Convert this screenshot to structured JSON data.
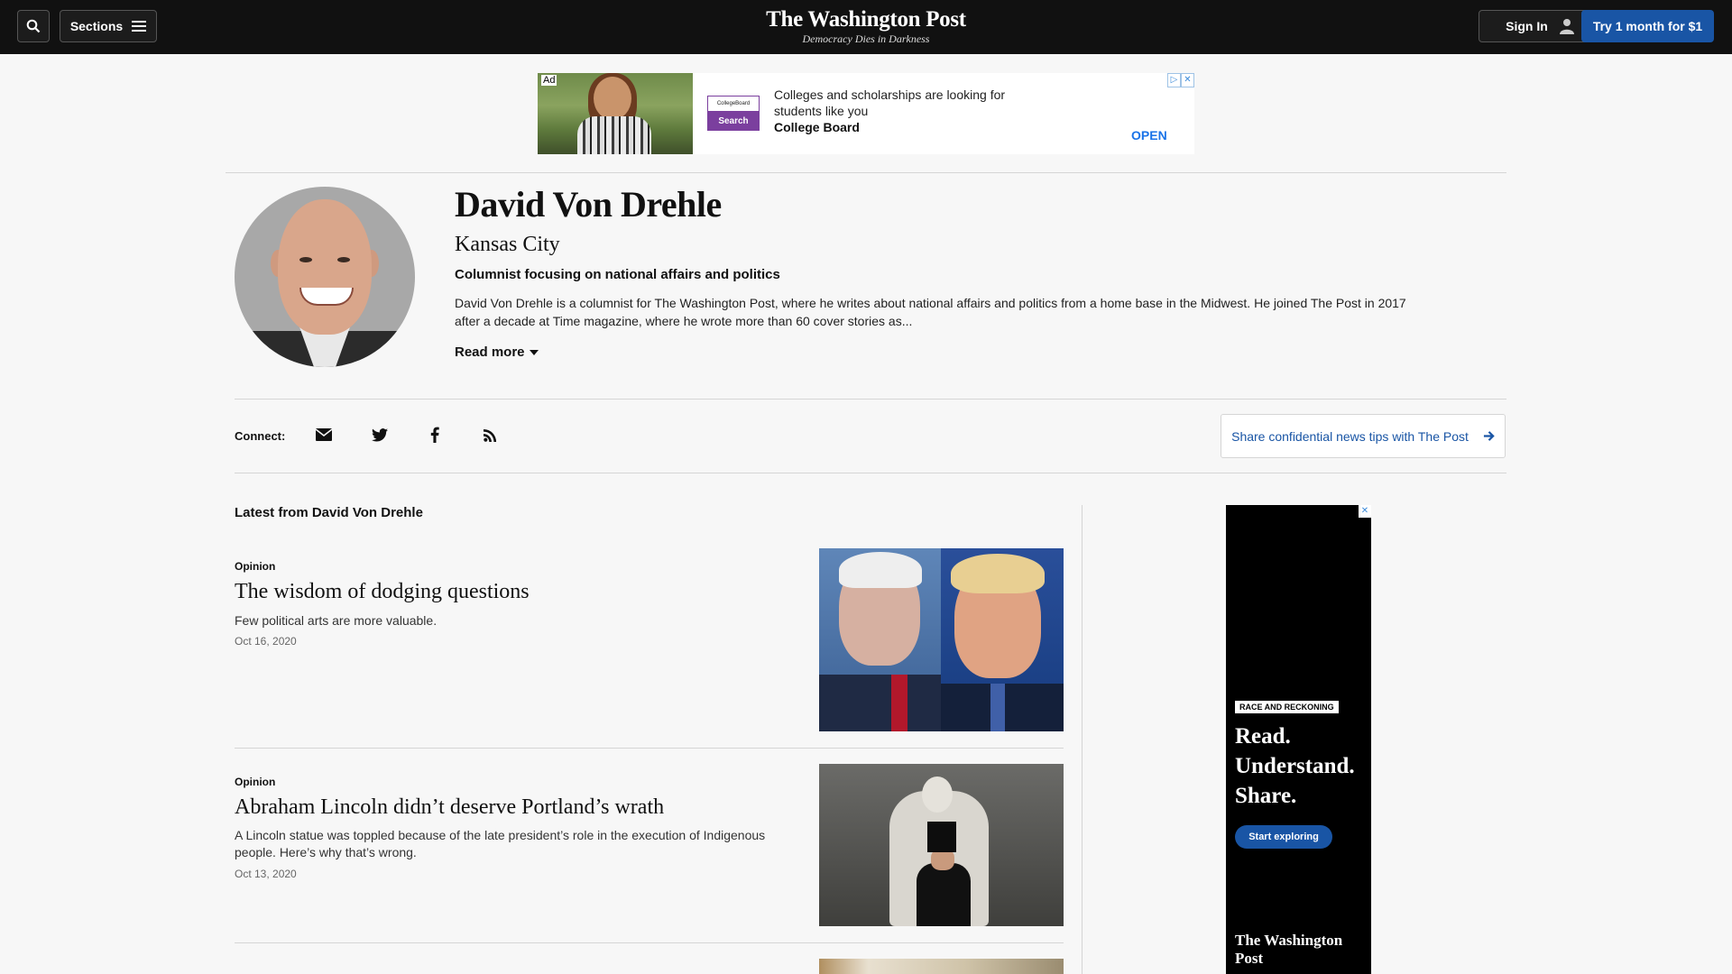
{
  "header": {
    "sections_label": "Sections",
    "logo": "The Washington Post",
    "tagline": "Democracy Dies in Darkness",
    "signin_label": "Sign In",
    "trial_label": "Try 1 month for $1"
  },
  "top_ad": {
    "label": "Ad",
    "brand_name": "CollegeBoard",
    "brand_button": "Search",
    "text": "Colleges and scholarships are looking for students like you",
    "company": "College Board",
    "cta": "OPEN"
  },
  "author": {
    "name": "David Von Drehle",
    "location": "Kansas City",
    "role": "Columnist focusing on national affairs and politics",
    "bio": "David Von Drehle is a columnist for The Washington Post, where he writes about national affairs and politics from a home base in the Midwest. He joined The Post in 2017 after a decade at Time magazine, where he wrote more than 60 cover stories as...",
    "read_more": "Read more"
  },
  "connect": {
    "label": "Connect:",
    "icons": [
      "email-icon",
      "twitter-icon",
      "facebook-icon",
      "rss-icon"
    ],
    "tips_label": "Share confidential news tips with The Post"
  },
  "feed": {
    "heading": "Latest from David Von Drehle",
    "articles": [
      {
        "kicker": "Opinion",
        "headline": "The wisdom of dodging questions",
        "blurb": "Few political arts are more valuable.",
        "date": "Oct 16, 2020"
      },
      {
        "kicker": "Opinion",
        "headline": "Abraham Lincoln didn’t deserve Portland’s wrath",
        "blurb": "A Lincoln statue was toppled because of the late president’s role in the execution of Indigenous people. Here’s why that’s wrong.",
        "date": "Oct 13, 2020"
      }
    ]
  },
  "side_ad": {
    "tag": "RACE AND RECKONING",
    "lines": [
      "Read.",
      "Understand.",
      "Share."
    ],
    "cta": "Start exploring",
    "brand": "The Washington Post"
  },
  "colors": {
    "topbar": "#111111",
    "accent_blue": "#1955a5",
    "background": "#f7f7f7"
  }
}
